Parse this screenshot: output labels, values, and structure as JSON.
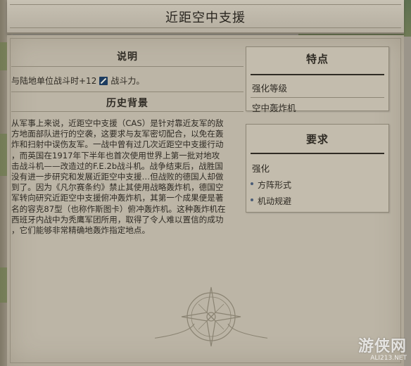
{
  "title": "近距空中支援",
  "description": {
    "heading": "说明",
    "text_before": "与陆地单位战斗时+12",
    "icon": "sword-icon",
    "text_after": "战斗力。"
  },
  "history": {
    "heading": "历史背景",
    "lines": [
      "从军事上来说，近距空中支援（CAS）是针对靠近友军的敌",
      "方地面部队进行的空袭，这要求与友军密切配合，以免在轰",
      "炸和扫射中误伤友军。一战中曾有过几次近距空中支援行动",
      "，而英国在1917年下半年也首次使用世界上第一批对地攻",
      "击战斗机——改造过的F.E.2b战斗机。战争结束后，战胜国",
      "没有进一步研究和发展近距空中支援…但战败的德国人却做",
      "到了。因为《凡尔赛条约》禁止其使用战略轰炸机，德国空",
      "军转向研究近距空中支援俯冲轰炸机，其第一个成果便是著",
      "名的容克87型（也称作斯图卡）俯冲轰炸机。这种轰炸机在",
      "西班牙内战中为秃鹰军团所用，取得了令人难以置信的成功",
      "，它们能够非常精确地轰炸指定地点。"
    ]
  },
  "features": {
    "heading": "特点",
    "label": "强化等级",
    "value": "空中轰炸机"
  },
  "requirements": {
    "heading": "要求",
    "label": "强化",
    "items": [
      "方阵形式",
      "机动规避"
    ]
  },
  "watermark": {
    "big": "游侠网",
    "small": "ALI213.NET"
  },
  "colors": {
    "panel": "#bcb5a6",
    "title_bar": "#c8c2b4",
    "text": "#2f2b24",
    "icon_bg": "#1d3c60",
    "bullet": "#4a5c76"
  }
}
